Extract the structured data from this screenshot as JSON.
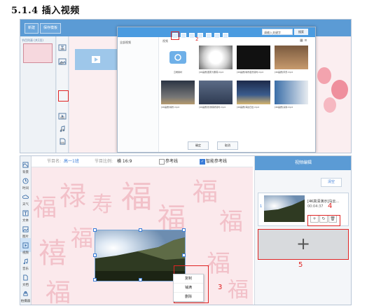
{
  "heading": "5.1.4 插入视频",
  "shot1": {
    "top_tabs": [
      "新建",
      "保存模板"
    ],
    "left_label": "节目列表 (共1页)",
    "tools": [
      "文本",
      "图片",
      "视频",
      "音乐",
      "文档",
      "时钟"
    ],
    "dialog": {
      "search_placeholder": "请输入关键字",
      "search_button": "搜索",
      "folder_label": "全部视频",
      "path_text": "视频",
      "items": [
        {
          "caption": "云端素材",
          "kind": "folder"
        },
        {
          "caption": "[4K画质]国家大剧院.mp4",
          "kind": "white"
        },
        {
          "caption": "[4K画质]城市夜景延时.mp4",
          "kind": "dark"
        },
        {
          "caption": "[4K画质]风景.mp4",
          "kind": "person"
        },
        {
          "caption": "[4K画质]城市.mp4",
          "kind": "night"
        },
        {
          "caption": "[4K画质]伦敦塔桥延时.mp4",
          "kind": "bridge"
        },
        {
          "caption": "[4K画质]海边日出.mp4",
          "kind": "sea"
        },
        {
          "caption": "[4K画质]演讲.mp4",
          "kind": "speaker"
        }
      ],
      "ok_label": "确定",
      "cancel_label": "取消"
    },
    "marker_1": "1",
    "marker_2": "2"
  },
  "shot2": {
    "bar": {
      "name_label": "节目名:",
      "name_value": "高一1班",
      "ratio_label": "节目比例:",
      "ratio_value": "横 16:9",
      "guide_label": "参考线",
      "smart_guide_label": "智能参考线",
      "smart_guide_checked": true
    },
    "tools": [
      {
        "label": "背景",
        "icon": "background-icon"
      },
      {
        "label": "时间",
        "icon": "clock-icon"
      },
      {
        "label": "天气",
        "icon": "weather-icon"
      },
      {
        "label": "文本",
        "icon": "text-icon"
      },
      {
        "label": "图片",
        "icon": "image-icon"
      },
      {
        "label": "视频",
        "icon": "video-icon",
        "active": true
      },
      {
        "label": "音乐",
        "icon": "music-icon"
      },
      {
        "label": "文档",
        "icon": "document-icon"
      },
      {
        "label": "拍摄器",
        "icon": "camera-icon"
      }
    ],
    "context_menu": [
      "复制",
      "铺满",
      "删除"
    ],
    "marker_3": "3",
    "panel": {
      "title": "视频编辑",
      "clear_label": "清空",
      "item_num": "1",
      "item_name": "[4K高清演示]乌云...",
      "item_time": "00:04:37",
      "marker_4": "4",
      "marker_5": "5",
      "add_symbol": "+"
    }
  },
  "colors": {
    "accent": "#5b9bd5",
    "annotation_red": "#e02424",
    "canvas_pink": "#fbe9ec"
  }
}
